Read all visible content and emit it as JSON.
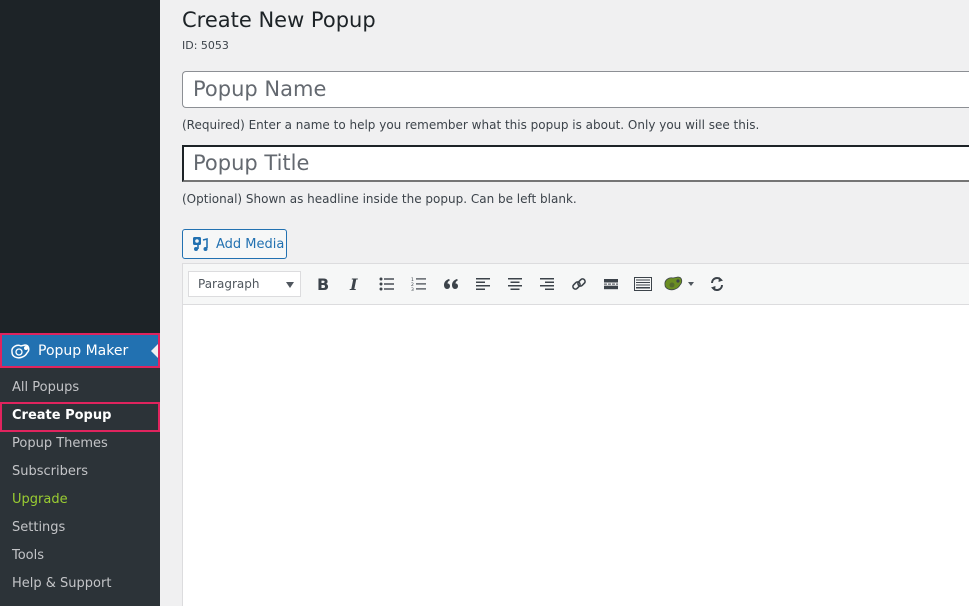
{
  "sidebar": {
    "menu_head": {
      "label": "Popup Maker",
      "icon": "popup-maker-icon"
    },
    "items": [
      {
        "label": "All Popups",
        "state": "normal"
      },
      {
        "label": "Create Popup",
        "state": "current"
      },
      {
        "label": "Popup Themes",
        "state": "normal"
      },
      {
        "label": "Subscribers",
        "state": "normal"
      },
      {
        "label": "Upgrade",
        "state": "upgrade"
      },
      {
        "label": "Settings",
        "state": "normal"
      },
      {
        "label": "Tools",
        "state": "normal"
      },
      {
        "label": "Help & Support",
        "state": "normal"
      }
    ],
    "colors": {
      "highlight_border": "#e0245e",
      "menu_active": "#2271b1",
      "upgrade": "#9acd32"
    }
  },
  "main": {
    "title": "Create New Popup",
    "id_label": "ID: 5053",
    "name_field": {
      "value": "",
      "placeholder": "Popup Name",
      "hint": "(Required) Enter a name to help you remember what this popup is about. Only you will see this."
    },
    "title_field": {
      "value": "",
      "placeholder": "Popup Title",
      "hint": "(Optional) Shown as headline inside the popup. Can be left blank."
    },
    "add_media_label": "Add Media",
    "editor": {
      "format_select": "Paragraph",
      "toolbar_icons": [
        "bold-icon",
        "italic-icon",
        "bullet-list-icon",
        "numbered-list-icon",
        "blockquote-icon",
        "align-left-icon",
        "align-center-icon",
        "align-right-icon",
        "link-icon",
        "read-more-icon",
        "toolbar-toggle-icon",
        "popup-maker-shortcode-icon",
        "refresh-icon"
      ],
      "content": ""
    }
  }
}
